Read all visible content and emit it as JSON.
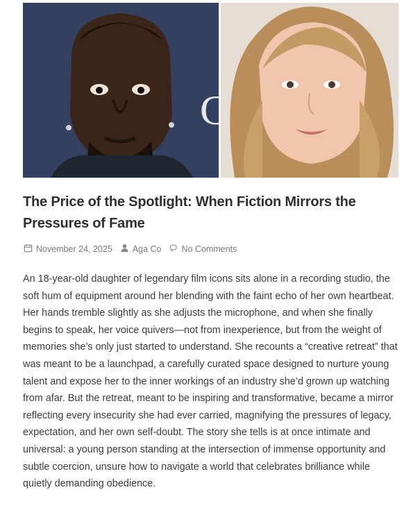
{
  "post": {
    "title": "The Price of the Spotlight: When Fiction Mirrors the Pressures of Fame",
    "meta": {
      "date": "November 24, 2025",
      "author": "Aga Co",
      "comments": "No Comments"
    },
    "body": "An 18-year-old daughter of legendary film icons sits alone in a recording studio, the soft hum of equipment around her blending with the faint echo of her own heartbeat. Her hands tremble slightly as she adjusts the microphone, and when she finally begins to speak, her voice quivers—not from inexperience, but from the weight of memories she’s only just started to understand. She recounts a “creative retreat” that was meant to be a launchpad, a carefully curated space designed to nurture young talent and expose her to the inner workings of an industry she’d grown up watching from afar. But the retreat, meant to be inspiring and transformative, became a mirror reflecting every insecurity she had ever carried, magnifying the pressures of legacy, expectation, and her own self-doubt. The story she tells is at once intimate and universal: a young person standing at the intersection of immense opportunity and subtle coercion, unsure how to navigate a world that celebrates brilliance while quietly demanding obedience."
  },
  "icons": {
    "date": "calendar-icon",
    "author": "user-icon",
    "comments": "comments-icon"
  }
}
